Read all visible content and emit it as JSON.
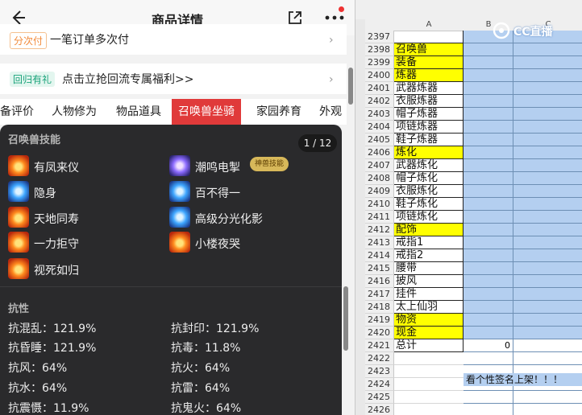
{
  "header": {
    "title": "商品详情"
  },
  "promos": [
    {
      "tag": "分次付",
      "text": "一笔订单多次付",
      "tag_color": "#f28a3a"
    },
    {
      "tag": "回归有礼",
      "text": "点击立抢回流专属福利>>",
      "tag_color": "#1aa37a"
    }
  ],
  "tabs": [
    {
      "label": "备评价"
    },
    {
      "label": "人物修为"
    },
    {
      "label": "物品道具"
    },
    {
      "label": "召唤兽坐骑",
      "active": true
    },
    {
      "label": "家园养育"
    },
    {
      "label": "外观"
    }
  ],
  "popup": {
    "section_skills": "召唤兽技能",
    "page_indicator": "1 / 12",
    "badge": "神兽技能",
    "skills": [
      {
        "name": "有凤来仪",
        "icon": "fire"
      },
      {
        "name": "潮鸣电掣",
        "icon": "purple"
      },
      {
        "name": "隐身",
        "icon": "blue"
      },
      {
        "name": "百不得一",
        "icon": "blue"
      },
      {
        "name": "天地同寿",
        "icon": "fire"
      },
      {
        "name": "高级分光化影",
        "icon": "blue"
      },
      {
        "name": "一力拒守",
        "icon": "fire"
      },
      {
        "name": "小楼夜哭",
        "icon": "fire"
      },
      {
        "name": "视死如归",
        "icon": "fire"
      }
    ],
    "section_resist": "抗性",
    "resists": [
      "抗混乱：121.9%",
      "抗封印：121.9%",
      "抗昏睡：121.9%",
      "抗毒：11.8%",
      "抗风：64%",
      "抗火：64%",
      "抗水：64%",
      "抗雷：64%",
      "抗震慑：11.9%",
      "抗鬼火：64%"
    ]
  },
  "sheet": {
    "col_a": "A",
    "col_b": "B",
    "col_c": "C",
    "logo_text": "CC直播",
    "rows": [
      {
        "n": "2397",
        "a": "",
        "y": false
      },
      {
        "n": "2398",
        "a": "召唤兽",
        "y": true
      },
      {
        "n": "2399",
        "a": "装备",
        "y": true
      },
      {
        "n": "2400",
        "a": "炼器",
        "y": true
      },
      {
        "n": "2401",
        "a": "武器炼器",
        "y": false
      },
      {
        "n": "2402",
        "a": "衣服炼器",
        "y": false
      },
      {
        "n": "2403",
        "a": "帽子炼器",
        "y": false
      },
      {
        "n": "2404",
        "a": "项链炼器",
        "y": false
      },
      {
        "n": "2405",
        "a": "鞋子炼器",
        "y": false
      },
      {
        "n": "2406",
        "a": "炼化",
        "y": true
      },
      {
        "n": "2407",
        "a": "武器炼化",
        "y": false
      },
      {
        "n": "2408",
        "a": "帽子炼化",
        "y": false
      },
      {
        "n": "2409",
        "a": "衣服炼化",
        "y": false
      },
      {
        "n": "2410",
        "a": "鞋子炼化",
        "y": false
      },
      {
        "n": "2411",
        "a": "项链炼化",
        "y": false
      },
      {
        "n": "2412",
        "a": "配饰",
        "y": true
      },
      {
        "n": "2413",
        "a": "戒指1",
        "y": false
      },
      {
        "n": "2414",
        "a": "戒指2",
        "y": false
      },
      {
        "n": "2415",
        "a": "腰带",
        "y": false
      },
      {
        "n": "2416",
        "a": "披风",
        "y": false
      },
      {
        "n": "2417",
        "a": "挂件",
        "y": false
      },
      {
        "n": "2418",
        "a": "太上仙羽",
        "y": false
      },
      {
        "n": "2419",
        "a": "物资",
        "y": true
      },
      {
        "n": "2420",
        "a": "现金",
        "y": true
      },
      {
        "n": "2421",
        "a": "总计",
        "y": false,
        "b": "0"
      },
      {
        "n": "2422",
        "a": "",
        "y": false
      },
      {
        "n": "2423",
        "a": "",
        "y": false
      },
      {
        "n": "2424",
        "a": "",
        "y": false
      },
      {
        "n": "2425",
        "a": "",
        "y": false
      },
      {
        "n": "2426",
        "a": "",
        "y": false
      }
    ],
    "note": "看个性签名上架！！！"
  }
}
